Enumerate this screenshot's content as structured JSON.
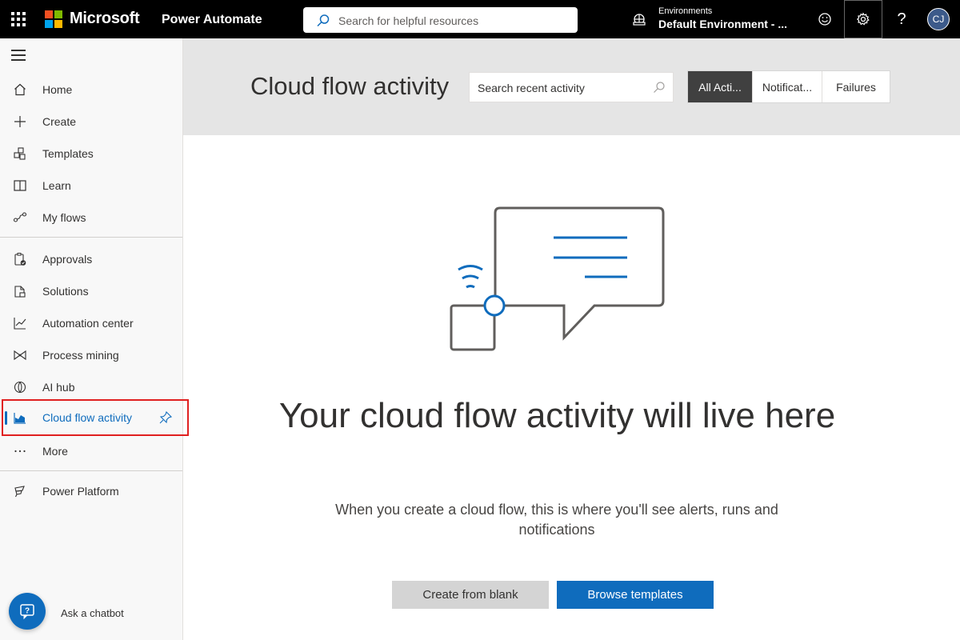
{
  "topbar": {
    "brand": "Microsoft",
    "app_name": "Power Automate",
    "search_placeholder": "Search for helpful resources",
    "environment_label": "Environments",
    "environment_name": "Default Environment - ...",
    "help_glyph": "?",
    "avatar_initials": "CJ",
    "icons": [
      "app-launcher-icon",
      "microsoft-logo-icon",
      "search-icon",
      "environment-icon",
      "smiley-icon",
      "gear-icon",
      "help-icon"
    ]
  },
  "sidebar": {
    "items": [
      {
        "label": "Home",
        "icon": "home-icon"
      },
      {
        "label": "Create",
        "icon": "plus-icon"
      },
      {
        "label": "Templates",
        "icon": "templates-icon"
      },
      {
        "label": "Learn",
        "icon": "book-icon"
      },
      {
        "label": "My flows",
        "icon": "flows-icon"
      },
      {
        "label": "Approvals",
        "icon": "approvals-icon"
      },
      {
        "label": "Solutions",
        "icon": "solutions-icon"
      },
      {
        "label": "Automation center",
        "icon": "chart-line-icon"
      },
      {
        "label": "Process mining",
        "icon": "process-mining-icon"
      },
      {
        "label": "AI hub",
        "icon": "ai-hub-icon"
      },
      {
        "label": "Cloud flow activity",
        "icon": "activity-chart-icon",
        "active": true
      },
      {
        "label": "More",
        "icon": "ellipsis-icon"
      },
      {
        "label": "Power Platform",
        "icon": "power-platform-icon"
      }
    ],
    "chatbot_label": "Ask a chatbot"
  },
  "main": {
    "title": "Cloud flow activity",
    "search_placeholder": "Search recent activity",
    "tabs": [
      {
        "label": "All Acti...",
        "selected": true
      },
      {
        "label": "Notificat...",
        "selected": false
      },
      {
        "label": "Failures",
        "selected": false
      }
    ],
    "empty_title": "Your cloud flow activity will live here",
    "empty_subtitle": "When you create a cloud flow, this is where you'll see alerts, runs and notifications",
    "btn_create_blank": "Create from blank",
    "btn_browse_templates": "Browse templates"
  },
  "colors": {
    "accent": "#0f6cbd",
    "topbar_bg": "#000000",
    "header_band": "#e5e5e5",
    "highlight_box": "#e02020",
    "ms_red": "#f25022",
    "ms_green": "#7fba00",
    "ms_blue": "#00a4ef",
    "ms_yellow": "#ffb900"
  }
}
